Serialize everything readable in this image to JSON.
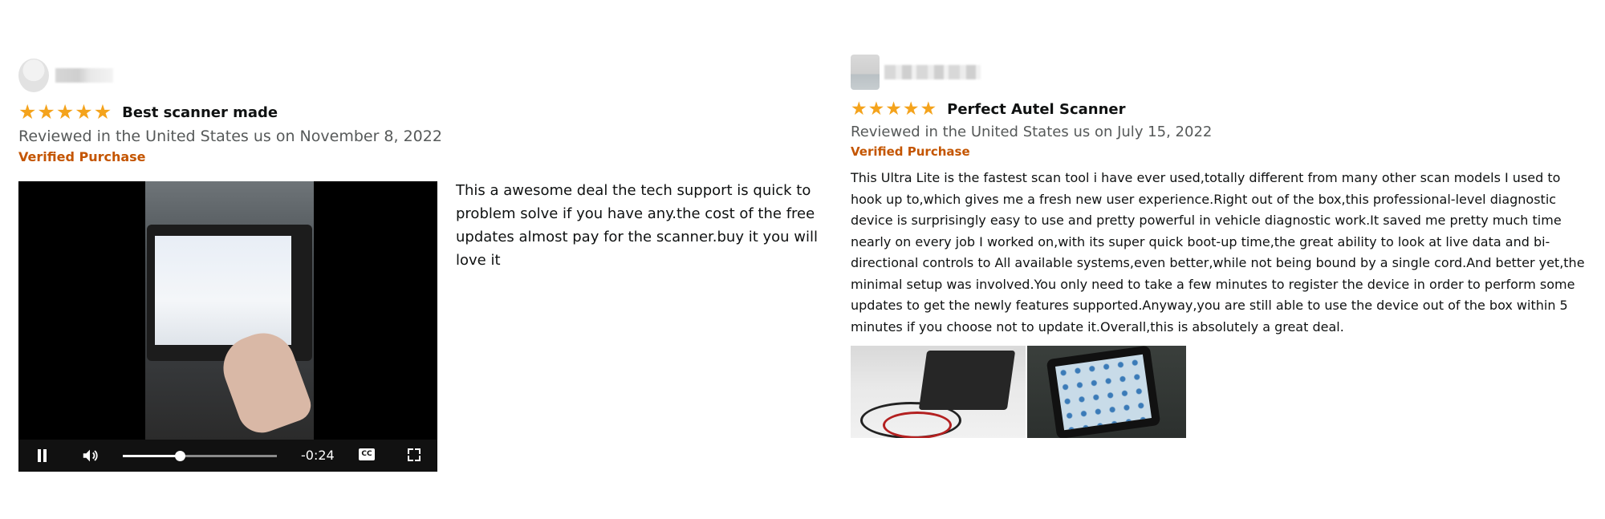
{
  "reviews": [
    {
      "rating": 5,
      "rating_max": 5,
      "title": "Best scanner made",
      "meta": "Reviewed in the United States us on November 8, 2022",
      "verified": "Verified Purchase",
      "body": " This a awesome deal the tech support is quick to problem solve if you have any.the cost of the free updates almost pay for the scanner.buy it you will love it",
      "video": {
        "time_remaining": "-0:24",
        "progress": 0.37,
        "cc_label": "CC"
      }
    },
    {
      "rating": 5,
      "rating_max": 5,
      "title": "Perfect Autel Scanner",
      "meta": "Reviewed in the United States us on July 15, 2022",
      "verified": "Verified Purchase",
      "body": "This Ultra Lite is the fastest scan tool i have ever used,totally different from many other scan models I used to hook up to,which gives me a fresh new user experience.Right out of the box,this professional-level diagnostic device is surprisingly easy to use and pretty powerful in vehicle diagnostic work.It saved me pretty much time nearly on every job I worked on,with its super quick boot-up time,the great ability to look at live data and bi-directional controls to All available systems,even better,while not being bound by a single cord.And better yet,the minimal setup was involved.You only need to take a few minutes to register the device in order to perform some updates to get the newly features supported.Anyway,you are still able to use the device out of the box within 5 minutes if you choose not to update it.Overall,this is absolutely a great deal."
    }
  ],
  "colors": {
    "star": "#f4a31c",
    "verified": "#c45500",
    "meta": "#565959",
    "text": "#0f1111"
  },
  "icons": {
    "star": "★",
    "pause": "pause-icon",
    "volume": "volume-icon",
    "cc": "cc-icon",
    "fullscreen": "fullscreen-icon"
  }
}
